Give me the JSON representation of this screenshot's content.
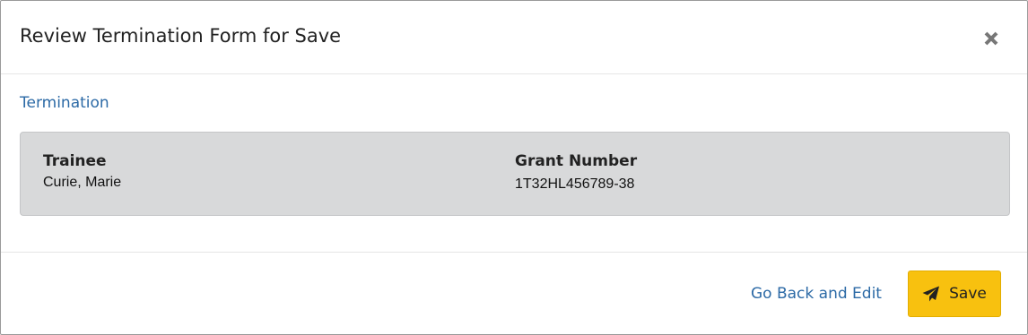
{
  "dialog": {
    "title": "Review Termination Form for Save",
    "close_icon": "close-icon"
  },
  "section": {
    "title": "Termination"
  },
  "fields": {
    "trainee": {
      "label": "Trainee",
      "value": "Curie, Marie"
    },
    "grant_number": {
      "label": "Grant Number",
      "value": "1T32HL456789-38"
    }
  },
  "footer": {
    "back_label": "Go Back and Edit",
    "save_label": "Save",
    "save_icon": "paper-plane-icon"
  },
  "colors": {
    "link": "#2c6aa6",
    "save_button": "#f8c10f",
    "panel": "#d8d9da"
  }
}
